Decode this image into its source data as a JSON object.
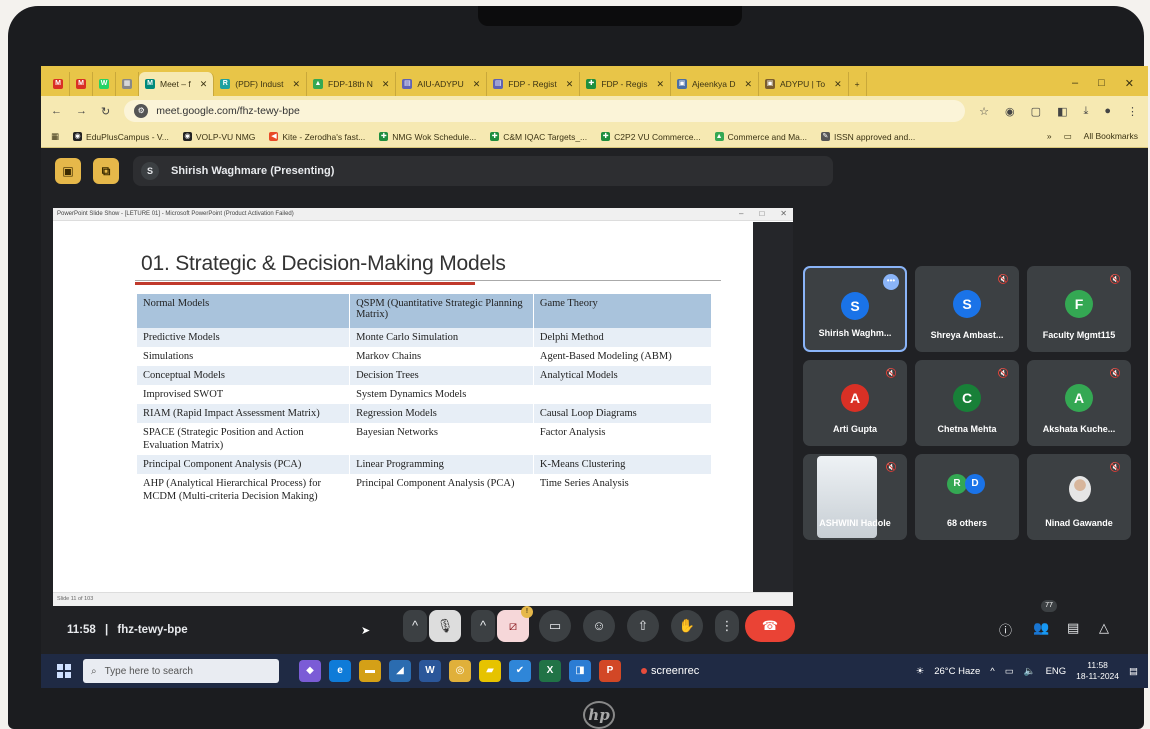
{
  "browser": {
    "tabs": [
      {
        "label": "",
        "icon": "M",
        "color": "#d93025"
      },
      {
        "label": "",
        "icon": "M",
        "color": "#d93025"
      },
      {
        "label": "",
        "icon": "W",
        "color": "#25d366"
      },
      {
        "label": "",
        "icon": "▦",
        "color": "#888888"
      },
      {
        "label": "Meet – f",
        "icon": "M",
        "color": "#00897b",
        "active": true
      },
      {
        "label": "(PDF) Indust",
        "icon": "R",
        "color": "#1da1a0"
      },
      {
        "label": "FDP-18th N",
        "icon": "▲",
        "color": "#34a853"
      },
      {
        "label": "AIU-ADYPU",
        "icon": "▤",
        "color": "#5f63b4"
      },
      {
        "label": "FDP - Regist",
        "icon": "▤",
        "color": "#5f63b4"
      },
      {
        "label": "FDP - Regis",
        "icon": "✚",
        "color": "#1e8e3e"
      },
      {
        "label": "Ajeenkya D",
        "icon": "▣",
        "color": "#4a6fa5"
      },
      {
        "label": "ADYPU | To",
        "icon": "▣",
        "color": "#7a5c2e"
      }
    ],
    "new_tab": "+",
    "window_controls": [
      "–",
      "□",
      "✕"
    ],
    "url": "meet.google.com/fhz-tewy-bpe",
    "bookmarks": [
      {
        "label": "EduPlusCampus - V...",
        "icon": "◉",
        "color": "#222222"
      },
      {
        "label": "VOLP-VU NMG",
        "icon": "◉",
        "color": "#222222"
      },
      {
        "label": "Kite - Zerodha's fast...",
        "icon": "◀",
        "color": "#e84a27"
      },
      {
        "label": "NMG Wok Schedule...",
        "icon": "✚",
        "color": "#1e8e3e"
      },
      {
        "label": "C&M IQAC Targets_...",
        "icon": "✚",
        "color": "#1e8e3e"
      },
      {
        "label": "C2P2 VU Commerce...",
        "icon": "✚",
        "color": "#1e8e3e"
      },
      {
        "label": "Commerce and Ma...",
        "icon": "▲",
        "color": "#34a853"
      },
      {
        "label": "ISSN approved and...",
        "icon": "✎",
        "color": "#555555"
      }
    ],
    "all_bookmarks": "All Bookmarks"
  },
  "meet": {
    "presenter_initial": "S",
    "presenter_label": "Shirish Waghmare (Presenting)",
    "meeting_time": "11:58",
    "meeting_code": "fhz-tewy-bpe",
    "participants": [
      {
        "name": "Shirish Waghm...",
        "initial": "S",
        "color": "#1a73e8",
        "active": true
      },
      {
        "name": "Shreya Ambast...",
        "initial": "S",
        "color": "#1a73e8"
      },
      {
        "name": "Faculty Mgmt115",
        "initial": "F",
        "color": "#34a853"
      },
      {
        "name": "Arti Gupta",
        "initial": "A",
        "color": "#d93025"
      },
      {
        "name": "Chetna Mehta",
        "initial": "C",
        "color": "#188038"
      },
      {
        "name": "Akshata Kuche...",
        "initial": "A",
        "color": "#34a853"
      },
      {
        "name": "ASHWINI Hadole",
        "initial": "",
        "color": "#cccccc"
      },
      {
        "name": "68 others",
        "initial": "",
        "color": ""
      },
      {
        "name": "Ninad Gawande",
        "initial": "",
        "color": ""
      }
    ],
    "others_avatars": [
      "R",
      "D"
    ],
    "participant_count": "77",
    "raise_badge": "!"
  },
  "slide": {
    "window_title": "PowerPoint Slide Show - [LETURE 01] - Microsoft PowerPoint (Product Activation Failed)",
    "heading": "01. Strategic & Decision-Making Models",
    "columns": [
      "Normal Models",
      "QSPM (Quantitative Strategic Planning Matrix)",
      "Game Theory"
    ],
    "rows": [
      [
        "Predictive Models",
        "Monte Carlo Simulation",
        "Delphi Method"
      ],
      [
        "Simulations",
        "Markov Chains",
        "Agent-Based Modeling (ABM)"
      ],
      [
        "Conceptual Models",
        "Decision Trees",
        "Analytical Models"
      ],
      [
        "Improvised SWOT",
        "System Dynamics Models",
        ""
      ],
      [
        "RIAM (Rapid Impact Assessment Matrix)",
        "Regression Models",
        "Causal Loop Diagrams"
      ],
      [
        "SPACE (Strategic Position and Action Evaluation Matrix)",
        "Bayesian Networks",
        "Factor Analysis"
      ],
      [
        "Principal Component Analysis (PCA)",
        "Linear Programming",
        "K-Means Clustering"
      ],
      [
        "AHP (Analytical Hierarchical Process) for MCDM (Multi-criteria Decision Making)",
        "Principal Component Analysis (PCA)",
        "Time Series Analysis"
      ]
    ],
    "status": "Slide 11 of 103"
  },
  "taskbar": {
    "search_placeholder": "Type here to search",
    "apps": [
      {
        "icon": "◆",
        "color": "#7b5cd6"
      },
      {
        "icon": "e",
        "color": "#0f7bd8"
      },
      {
        "icon": "▬",
        "color": "#d4a017"
      },
      {
        "icon": "◢",
        "color": "#2b6cb0"
      },
      {
        "icon": "W",
        "color": "#2b579a"
      },
      {
        "icon": "◎",
        "color": "#e0b03a"
      },
      {
        "icon": "▰",
        "color": "#e6c300"
      },
      {
        "icon": "✔",
        "color": "#2f86d8"
      },
      {
        "icon": "X",
        "color": "#217346"
      },
      {
        "icon": "◨",
        "color": "#2b7cd3"
      },
      {
        "icon": "P",
        "color": "#d24726"
      }
    ],
    "screenrec": "screenrec",
    "weather": "26°C Haze",
    "lang": "ENG",
    "time": "11:58",
    "date": "18-11-2024"
  }
}
